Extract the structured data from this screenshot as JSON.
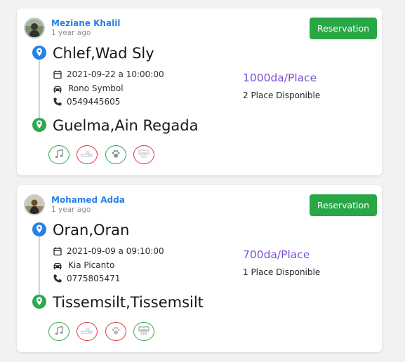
{
  "colors": {
    "accent_blue": "#2680e8",
    "price_purple": "#7b4fd6",
    "button_green": "#28a745",
    "allowed_border": "#2fa84f",
    "denied_border": "#dc3545"
  },
  "trips": [
    {
      "driver_name": "Meziane Khalil",
      "posted": "1 year ago",
      "reserve_label": "Reservation",
      "from": "Chlef,Wad Sly",
      "to": "Guelma,Ain Regada",
      "datetime": "2021-09-22 a 10:00:00",
      "car": "Rono Symbol",
      "phone": "0549445605",
      "price": "1000da/Place",
      "places": "2 Place Disponible",
      "amenities": [
        {
          "icon": "music-icon",
          "status": "allowed"
        },
        {
          "icon": "smoking-icon",
          "status": "denied"
        },
        {
          "icon": "paw-icon",
          "status": "allowed"
        },
        {
          "icon": "air-conditioner-icon",
          "status": "denied"
        }
      ]
    },
    {
      "driver_name": "Mohamed Adda",
      "posted": "1 year ago",
      "reserve_label": "Reservation",
      "from": "Oran,Oran",
      "to": "Tissemsilt,Tissemsilt",
      "datetime": "2021-09-09 a 09:10:00",
      "car": "Kia Picanto",
      "phone": "0775805471",
      "price": "700da/Place",
      "places": "1 Place Disponible",
      "amenities": [
        {
          "icon": "music-icon",
          "status": "allowed"
        },
        {
          "icon": "smoking-icon",
          "status": "denied"
        },
        {
          "icon": "paw-icon",
          "status": "denied"
        },
        {
          "icon": "air-conditioner-icon",
          "status": "allowed"
        }
      ]
    }
  ]
}
